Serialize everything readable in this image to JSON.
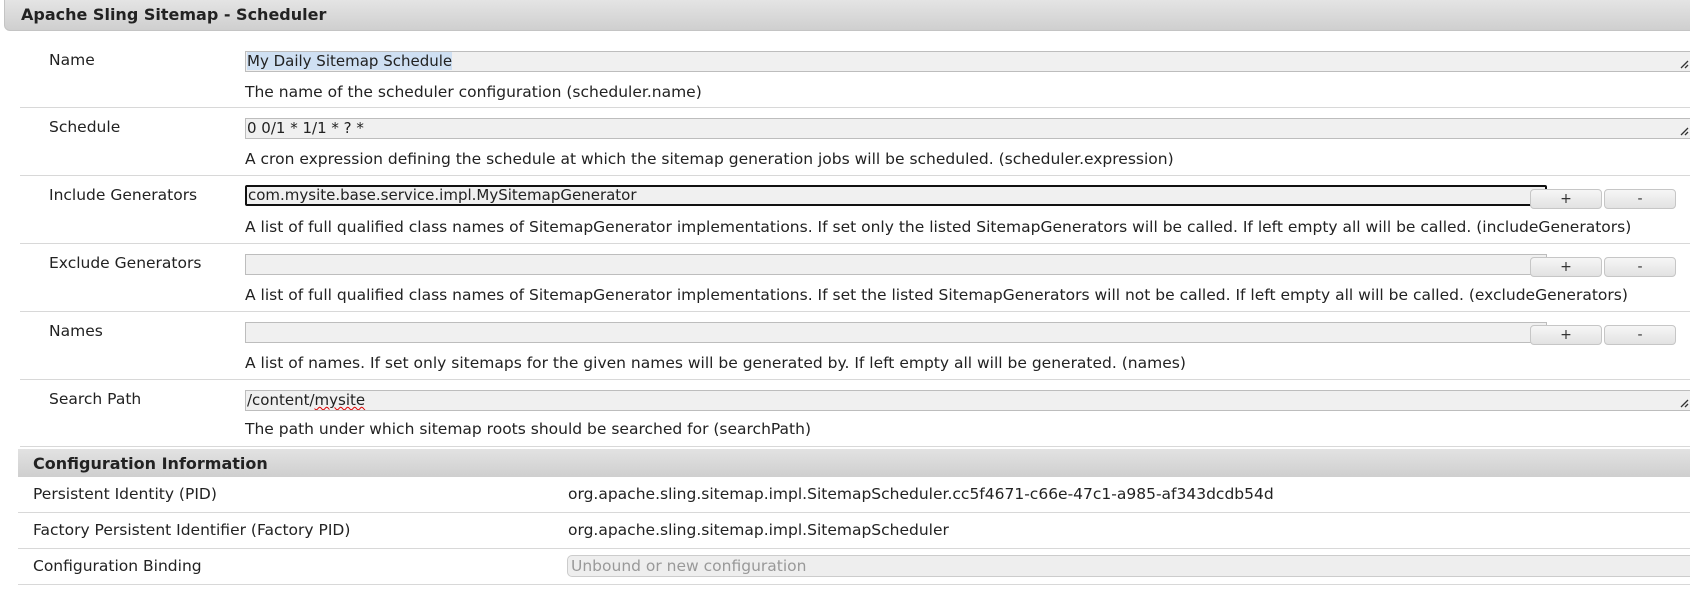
{
  "window": {
    "title": "Apache Sling Sitemap - Scheduler"
  },
  "properties": [
    {
      "label": "Name",
      "value": "My Daily Sitemap Schedule",
      "description": "The name of the scheduler configuration (scheduler.name)"
    },
    {
      "label": "Schedule",
      "value": "0 0/1 * 1/1 * ? *",
      "description": "A cron expression defining the schedule at which the sitemap generation jobs will be scheduled. (scheduler.expression)"
    },
    {
      "label": "Include Generators",
      "value": "com.mysite.base.service.impl.MySitemapGenerator",
      "description": "A list of full qualified class names of SitemapGenerator implementations. If set only the listed SitemapGenerators will be called. If left empty all will be called. (includeGenerators)"
    },
    {
      "label": "Exclude Generators",
      "value": "",
      "description": "A list of full qualified class names of SitemapGenerator implementations. If set the listed SitemapGenerators will not be called. If left empty all will be called. (excludeGenerators)"
    },
    {
      "label": "Names",
      "value": "",
      "description": "A list of names. If set only sitemaps for the given names will be generated by. If left empty all will be generated. (names)"
    },
    {
      "label": "Search Path",
      "value": "/content/mysite",
      "value_prefix": "/content/",
      "value_misspelled": "mysite",
      "description": "The path under which sitemap roots should be searched for (searchPath)"
    }
  ],
  "buttons": {
    "add_label": "+",
    "remove_label": "-"
  },
  "config_info": {
    "heading": "Configuration Information",
    "rows": [
      {
        "label": "Persistent Identity (PID)",
        "value": "org.apache.sling.sitemap.impl.SitemapScheduler.cc5f4671-c66e-47c1-a985-af343dcdb54d"
      },
      {
        "label": "Factory Persistent Identifier (Factory PID)",
        "value": "org.apache.sling.sitemap.impl.SitemapScheduler"
      },
      {
        "label": "Configuration Binding",
        "placeholder": "Unbound or new configuration"
      }
    ]
  }
}
